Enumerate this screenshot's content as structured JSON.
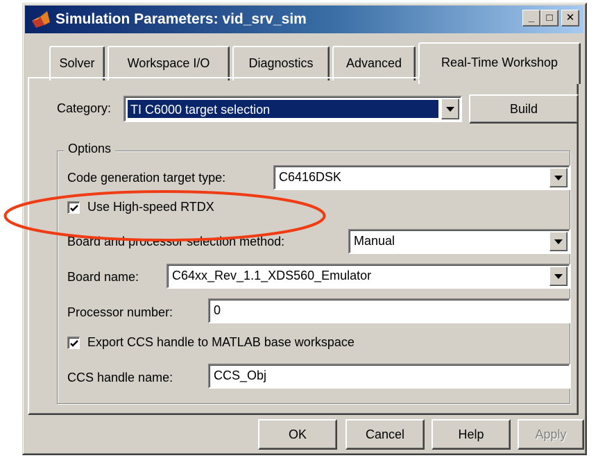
{
  "window": {
    "title": "Simulation Parameters: vid_srv_sim",
    "minimize_glyph": "_",
    "maximize_glyph": "□",
    "close_glyph": "✕"
  },
  "tabs": [
    {
      "label": "Solver",
      "active": false
    },
    {
      "label": "Workspace I/O",
      "active": false
    },
    {
      "label": "Diagnostics",
      "active": false
    },
    {
      "label": "Advanced",
      "active": false
    },
    {
      "label": "Real-Time Workshop",
      "active": true
    }
  ],
  "category": {
    "label": "Category:",
    "value": "TI C6000 target selection",
    "build_label": "Build"
  },
  "options": {
    "group_label": "Options",
    "code_gen_label": "Code generation target type:",
    "code_gen_value": "C6416DSK",
    "rtdx_label": "Use High-speed RTDX",
    "rtdx_checked": true,
    "board_method_label": "Board and processor selection method:",
    "board_method_value": "Manual",
    "board_name_label": "Board name:",
    "board_name_value": "C64xx_Rev_1.1_XDS560_Emulator",
    "processor_label": "Processor number:",
    "processor_value": "0",
    "export_label": "Export CCS handle to MATLAB base workspace",
    "export_checked": true,
    "ccs_handle_label": "CCS handle name:",
    "ccs_handle_value": "CCS_Obj"
  },
  "buttons": {
    "ok": "OK",
    "cancel": "Cancel",
    "help": "Help",
    "apply": "Apply"
  },
  "colors": {
    "face": "#d4d0c8",
    "title_dark": "#0a246a",
    "title_light": "#a6caf0",
    "selection": "#0a246a",
    "annotation": "#f03c14"
  }
}
